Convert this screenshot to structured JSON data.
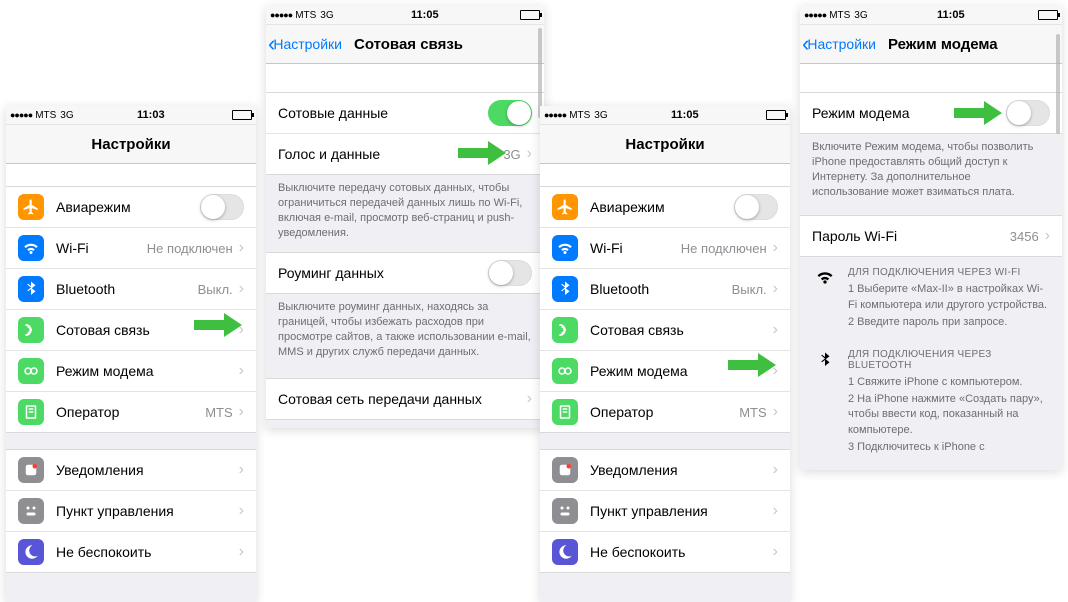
{
  "status": {
    "carrier": "MTS",
    "net": "3G",
    "time1": "11:03",
    "time2": "11:05"
  },
  "nav": {
    "settings_title": "Настройки",
    "back_label": "Настройки",
    "cellular_title": "Сотовая связь",
    "hotspot_title": "Режим модема"
  },
  "settings_items": {
    "airplane": "Авиарежим",
    "wifi": "Wi-Fi",
    "wifi_val": "Не подключен",
    "bluetooth": "Bluetooth",
    "bluetooth_val": "Выкл.",
    "cellular": "Сотовая связь",
    "hotspot": "Режим модема",
    "operator": "Оператор",
    "operator_val": "MTS",
    "notifications": "Уведомления",
    "control_center": "Пункт управления",
    "dnd": "Не беспокоить"
  },
  "cellular": {
    "cellular_data": "Сотовые данные",
    "voice_data": "Голос и данные",
    "voice_data_val": "3G",
    "note1": "Выключите передачу сотовых данных, чтобы ограничиться передачей данных лишь по Wi-Fi, включая e-mail, просмотр веб-страниц и push-уведомления.",
    "roaming": "Роуминг данных",
    "note2": "Выключите роуминг данных, находясь за границей, чтобы избежать расходов при просмотре сайтов, а также использовании e-mail, MMS и других служб передачи данных.",
    "network": "Сотовая сеть передачи данных"
  },
  "hotspot": {
    "toggle_label": "Режим модема",
    "note": "Включите Режим модема, чтобы позволить iPhone предоставлять общий доступ к Интернету. За дополнительное использование может взиматься плата.",
    "password_label": "Пароль Wi-Fi",
    "password_val": "3456",
    "wifi_hdr": "ДЛЯ ПОДКЛЮЧЕНИЯ ЧЕРЕЗ WI-FI",
    "wifi_1": "1 Выберите «Max-II» в настройках Wi-Fi компьютера или другого устройства.",
    "wifi_2": "2 Введите пароль при запросе.",
    "bt_hdr": "ДЛЯ ПОДКЛЮЧЕНИЯ ЧЕРЕЗ BLUETOOTH",
    "bt_1": "1 Свяжите iPhone с компьютером.",
    "bt_2": "2 На iPhone нажмите «Создать пару», чтобы ввести код, показанный на компьютере.",
    "bt_3": "3 Подключитесь к iPhone с"
  }
}
